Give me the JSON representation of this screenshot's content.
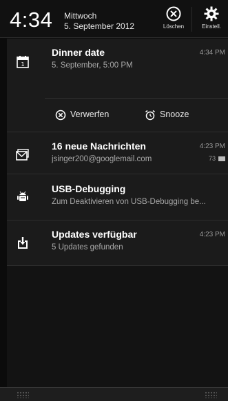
{
  "header": {
    "time": "4:34",
    "weekday": "Mittwoch",
    "date": "5. September 2012",
    "clear_label": "Löschen",
    "settings_label": "Einstell.",
    "clear_icon": "circle-x-icon",
    "settings_icon": "gear-icon"
  },
  "notifications": [
    {
      "icon": "calendar-icon",
      "title": "Dinner date",
      "subtitle": "5. September, 5:00 PM",
      "time": "4:34 PM",
      "actions": [
        {
          "label": "Verwerfen",
          "icon": "circle-x-icon"
        },
        {
          "label": "Snooze",
          "icon": "alarm-clock-icon"
        }
      ]
    },
    {
      "icon": "mail-icon",
      "title": "16 neue Nachrichten",
      "subtitle": "jsinger200@googlemail.com",
      "time": "4:23 PM",
      "count": "73"
    },
    {
      "icon": "android-debug-icon",
      "title": "USB-Debugging",
      "subtitle": "Zum Deaktivieren von USB-Debugging be..."
    },
    {
      "icon": "download-icon",
      "title": "Updates verfügbar",
      "subtitle": "5 Updates gefunden",
      "time": "4:23 PM"
    }
  ],
  "colors": {
    "background": "#0b0b0b",
    "card": "#1b1b1b",
    "text_primary": "#ffffff",
    "text_secondary": "#a8a8a8"
  }
}
